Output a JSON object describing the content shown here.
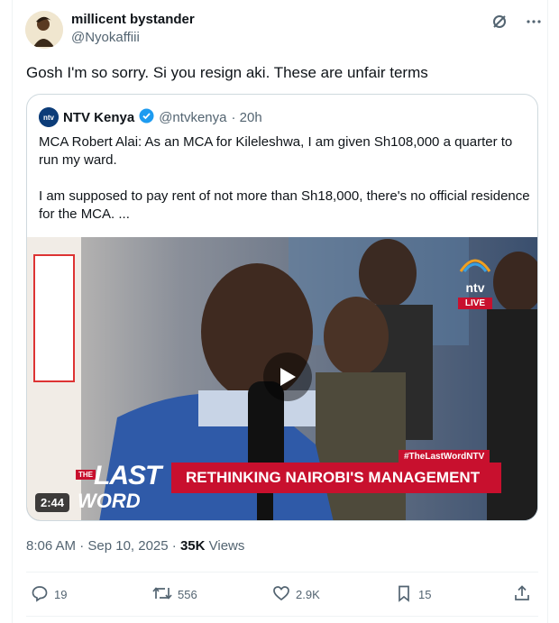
{
  "author": {
    "name": "millicent bystander",
    "handle": "@Nyokaffiii"
  },
  "tweet": {
    "text": "Gosh I'm so sorry. Si you resign aki. These are unfair terms"
  },
  "quote": {
    "name": "NTV Kenya",
    "handle": "@ntvkenya",
    "time": "· 20h",
    "para1": "MCA Robert Alai: As an MCA for Kileleshwa, I am given Sh108,000 a quarter to run my ward.",
    "para2": "I am supposed to pay rent of not more than Sh18,000, there's no official residence for the MCA. ...",
    "media": {
      "duration": "2:44",
      "banner": "RETHINKING NAIROBI'S MANAGEMENT",
      "hashtag": "#TheLastWordNTV",
      "show_the": "THE",
      "show_last": "LAST",
      "show_word": "WORD",
      "live": "LIVE",
      "ntv": "ntv"
    }
  },
  "meta": {
    "time": "8:06 AM · Sep 10, 2025 · ",
    "views_count": "35K",
    "views_label": " Views"
  },
  "actions": {
    "replies": "19",
    "reposts": "556",
    "likes": "2.9K",
    "bookmarks": "15"
  },
  "colors": {
    "accent": "#1d9bf0",
    "ntv_red": "#c8102e",
    "muted": "#536471"
  }
}
